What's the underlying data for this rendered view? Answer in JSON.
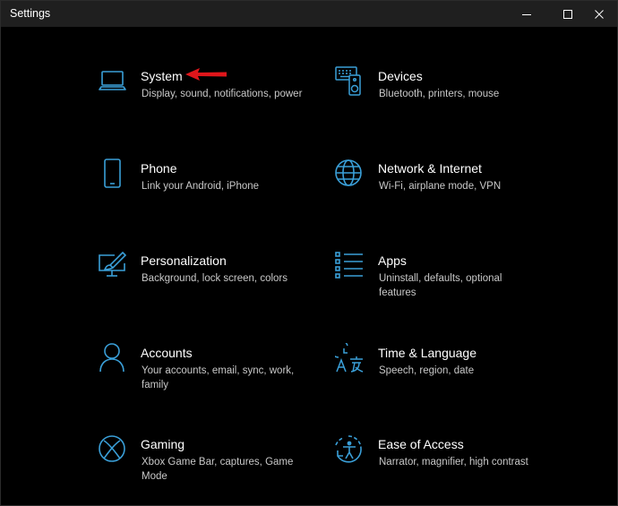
{
  "window": {
    "title": "Settings",
    "controls": {
      "minimize": "minimize-icon",
      "maximize": "maximize-icon",
      "close": "close-icon"
    }
  },
  "accent_color": "#3a9fd8",
  "annotation_color": "#e0161b",
  "tiles": [
    {
      "id": "system",
      "name": "System",
      "description": "Display, sound, notifications, power",
      "icon": "laptop-icon"
    },
    {
      "id": "devices",
      "name": "Devices",
      "description": "Bluetooth, printers, mouse",
      "icon": "keyboard-speaker-icon"
    },
    {
      "id": "phone",
      "name": "Phone",
      "description": "Link your Android, iPhone",
      "icon": "phone-icon"
    },
    {
      "id": "network",
      "name": "Network & Internet",
      "description": "Wi-Fi, airplane mode, VPN",
      "icon": "globe-icon"
    },
    {
      "id": "personalization",
      "name": "Personalization",
      "description": "Background, lock screen, colors",
      "icon": "paint-monitor-icon"
    },
    {
      "id": "apps",
      "name": "Apps",
      "description": "Uninstall, defaults, optional features",
      "icon": "apps-list-icon"
    },
    {
      "id": "accounts",
      "name": "Accounts",
      "description": "Your accounts, email, sync, work, family",
      "icon": "person-icon"
    },
    {
      "id": "time",
      "name": "Time & Language",
      "description": "Speech, region, date",
      "icon": "time-language-icon"
    },
    {
      "id": "gaming",
      "name": "Gaming",
      "description": "Xbox Game Bar, captures, Game Mode",
      "icon": "xbox-icon"
    },
    {
      "id": "ease",
      "name": "Ease of Access",
      "description": "Narrator, magnifier, high contrast",
      "icon": "ease-of-access-icon"
    }
  ]
}
